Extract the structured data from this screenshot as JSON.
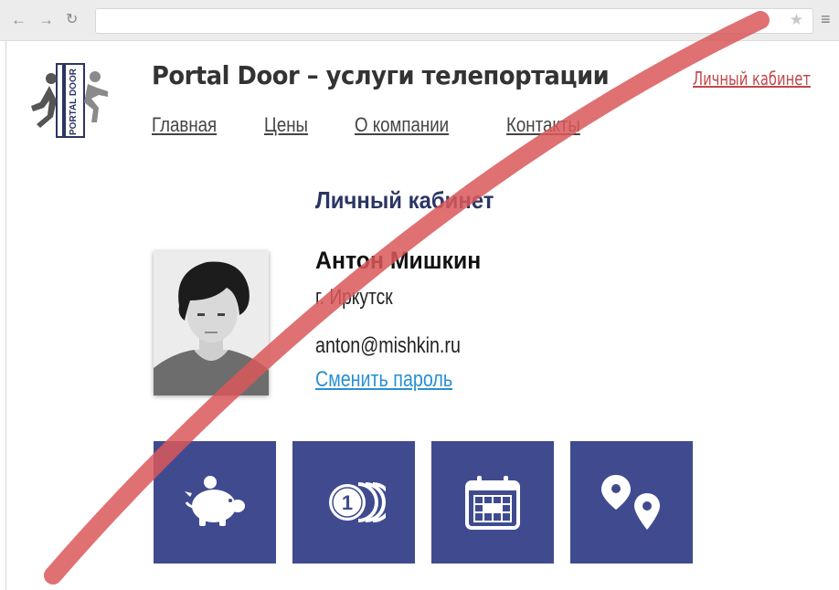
{
  "browser": {
    "back_icon": "back-arrow-icon",
    "forward_icon": "forward-arrow-icon",
    "reload_icon": "reload-icon",
    "bookmark_icon": "star-icon",
    "menu_icon": "hamburger-menu-icon"
  },
  "header": {
    "logo_text": "PORTAL DOOR",
    "site_title": "Portal Door – услуги телепортации",
    "account_link": "Личный кабинет",
    "nav": [
      "Главная",
      "Цены",
      "О компании",
      "Контакты"
    ]
  },
  "profile": {
    "section_title": "Личный кабинет",
    "name": "Антон Мишкин",
    "city": "г. Иркутск",
    "email": "anton@mishkin.ru",
    "change_password": "Сменить пароль"
  },
  "tiles": [
    {
      "icon": "piggy-bank-icon"
    },
    {
      "icon": "coins-icon",
      "badge": "1"
    },
    {
      "icon": "calendar-icon"
    },
    {
      "icon": "map-pins-icon"
    }
  ],
  "colors": {
    "tile_bg": "#404b8f",
    "title_dark": "#2b3564",
    "link_red": "#c0484b",
    "link_blue": "#2a8fd1",
    "strike": "#d9585b"
  }
}
